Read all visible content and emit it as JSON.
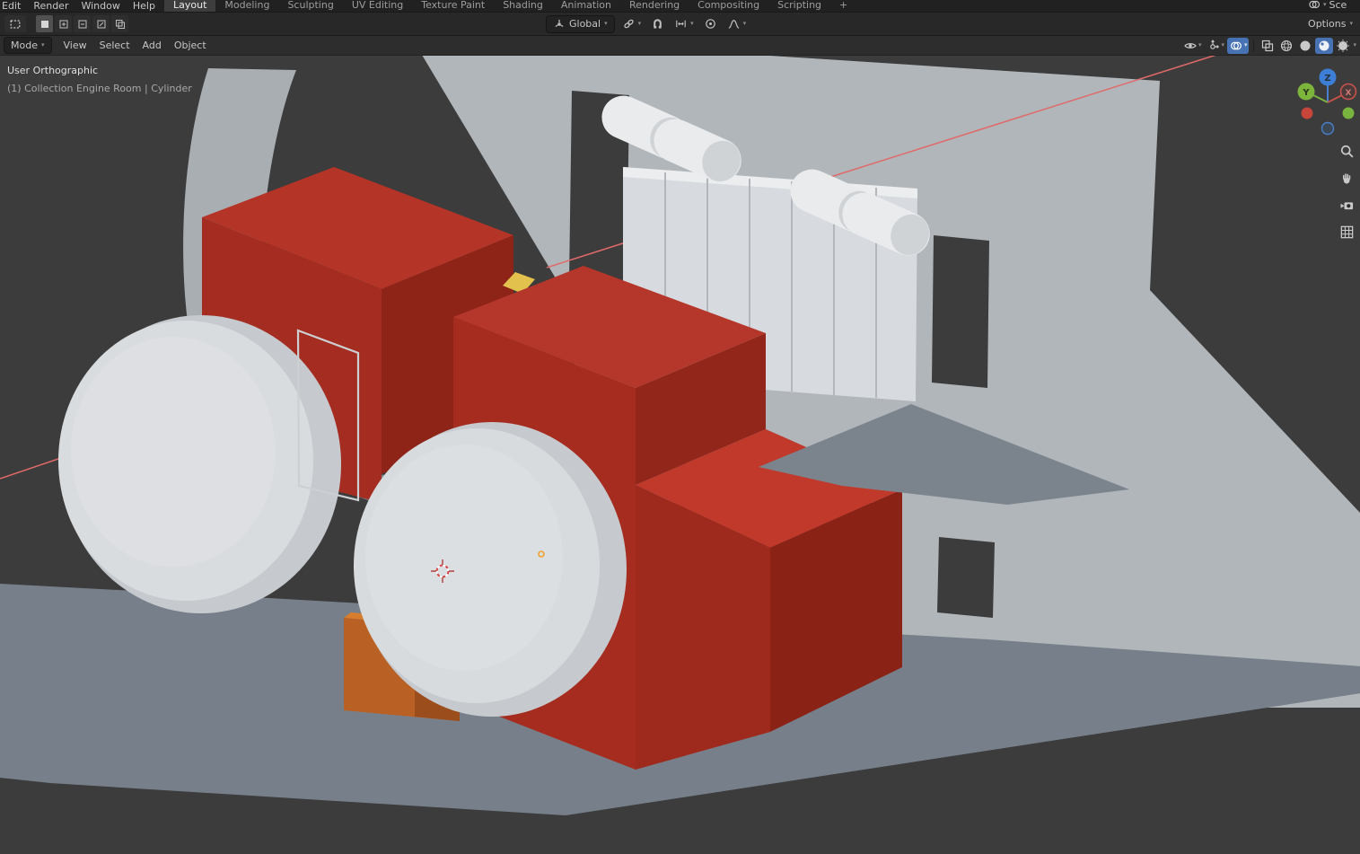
{
  "topbar": {
    "menus": [
      "Edit",
      "Render",
      "Window",
      "Help"
    ],
    "tabs": [
      "Layout",
      "Modeling",
      "Sculpting",
      "UV Editing",
      "Texture Paint",
      "Shading",
      "Animation",
      "Rendering",
      "Compositing",
      "Scripting"
    ],
    "add_tab": "+",
    "active_tab": "Layout",
    "scene_label": "Sce"
  },
  "tool_settings": {
    "orientation_label": "Global",
    "options_label": "Options"
  },
  "viewport_header": {
    "mode_label": "Mode",
    "menus": [
      "View",
      "Select",
      "Add",
      "Object"
    ]
  },
  "viewport": {
    "view_name": "User Orthographic",
    "breadcrumb": "(1) Collection Engine Room | Cylinder"
  },
  "gizmo": {
    "x_label": "X",
    "y_label": "Y",
    "z_label": "Z"
  },
  "icons": {
    "caret": "▾"
  },
  "colors": {
    "accent_blue": "#4772b3",
    "axis_x_red": "#e06a6a",
    "hull_gray": "#b1b6ba",
    "deck_gray": "#79828b",
    "engine_red": "#a52c20",
    "panel_white": "#d7dade",
    "viewport_bg": "#3c3c3c"
  }
}
